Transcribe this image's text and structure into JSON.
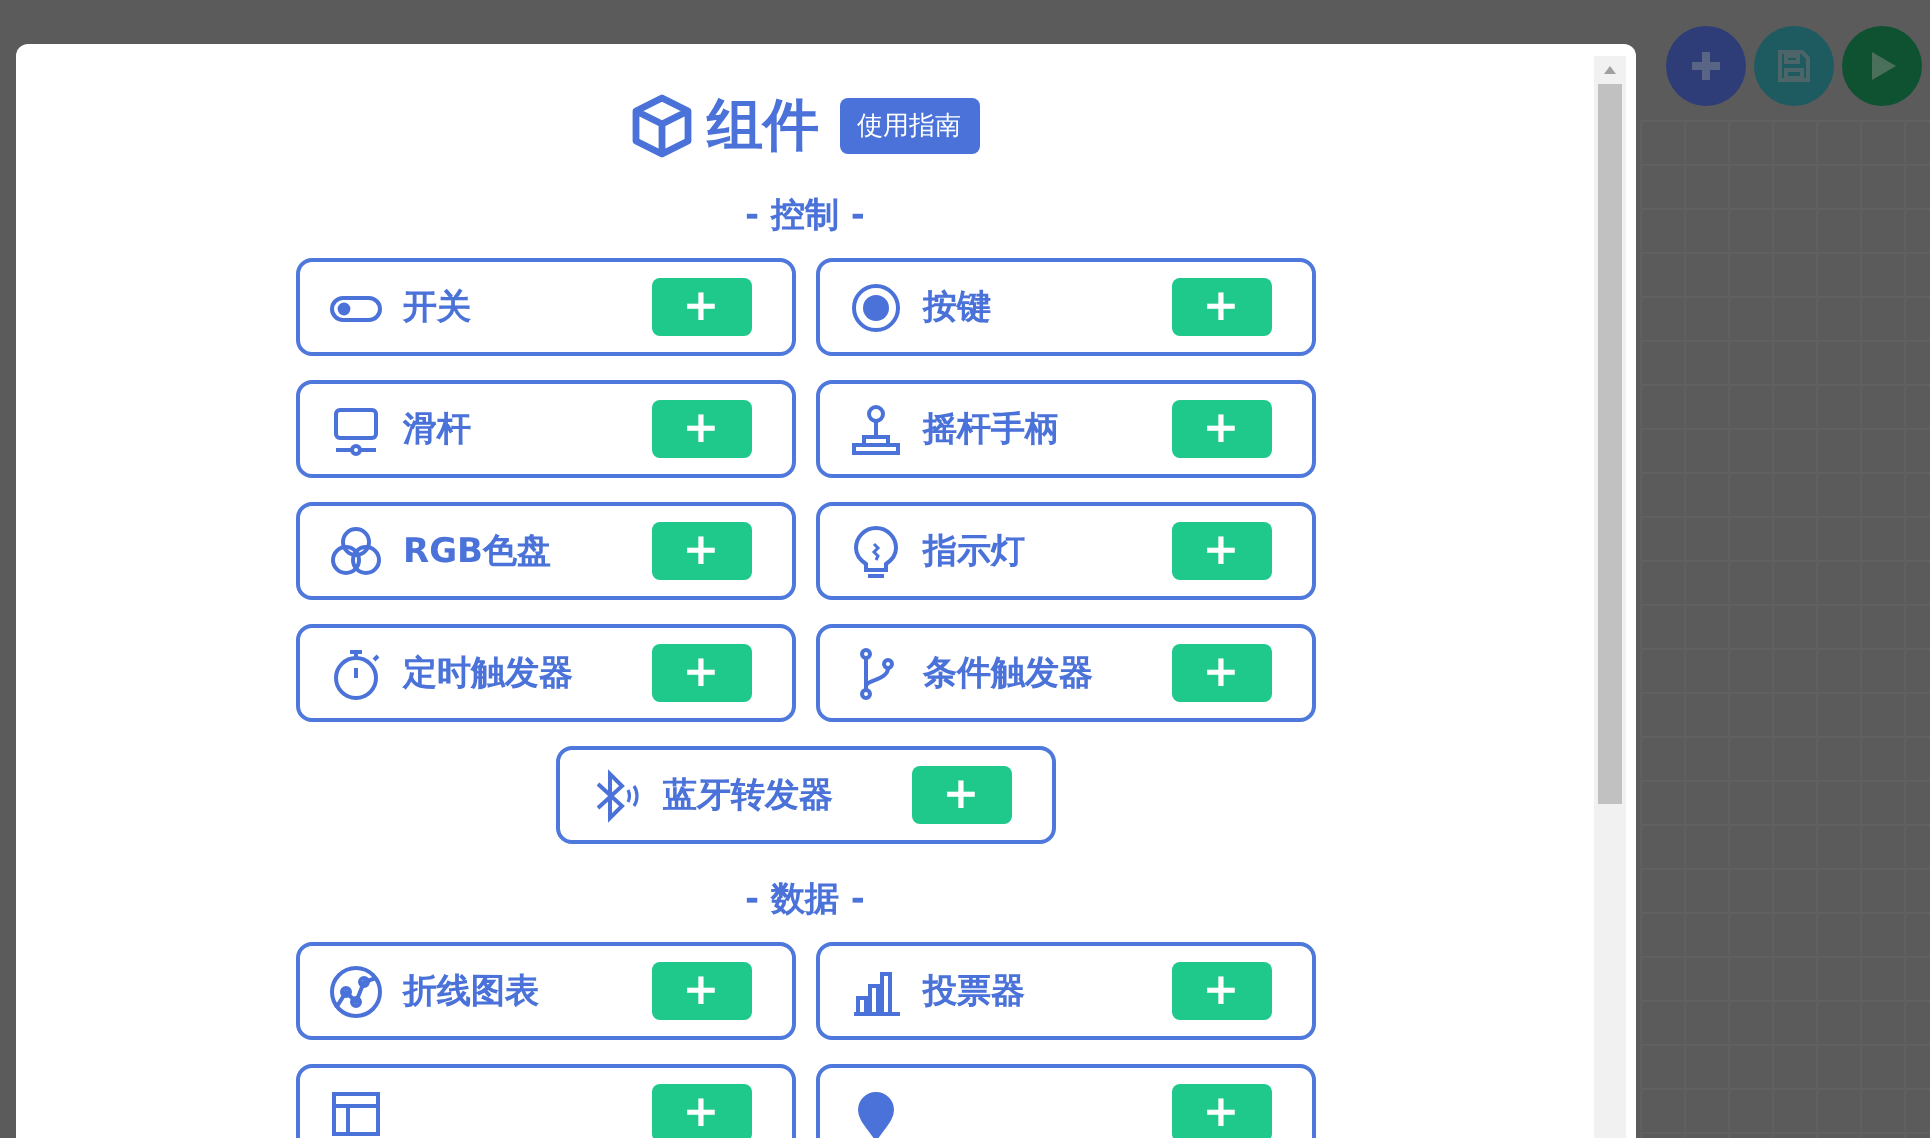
{
  "dialog": {
    "title": "组件",
    "guide_button": "使用指南",
    "sections": [
      {
        "heading": "- 控制 -",
        "items": [
          {
            "label": "开关",
            "add": "+"
          },
          {
            "label": "按键",
            "add": "+"
          },
          {
            "label": "滑杆",
            "add": "+"
          },
          {
            "label": "摇杆手柄",
            "add": "+"
          },
          {
            "label": "RGB色盘",
            "add": "+"
          },
          {
            "label": "指示灯",
            "add": "+"
          },
          {
            "label": "定时触发器",
            "add": "+"
          },
          {
            "label": "条件触发器",
            "add": "+"
          },
          {
            "label": "蓝牙转发器",
            "add": "+"
          }
        ]
      },
      {
        "heading": "- 数据 -",
        "items": [
          {
            "label": "折线图表",
            "add": "+"
          },
          {
            "label": "投票器",
            "add": "+"
          },
          {
            "add": "+"
          },
          {
            "add": "+"
          }
        ]
      }
    ]
  },
  "toolbar": [
    {
      "kind": "add"
    },
    {
      "kind": "save"
    },
    {
      "kind": "run"
    }
  ]
}
